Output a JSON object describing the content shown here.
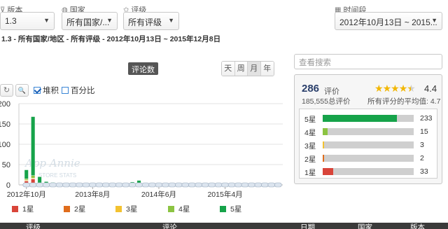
{
  "filters": {
    "version": {
      "label": "版本",
      "icon": "filter-icon",
      "value": "1.3"
    },
    "country": {
      "label": "国家",
      "icon": "globe-icon",
      "value": "所有国家/..."
    },
    "rating": {
      "label": "评级",
      "icon": "star-icon",
      "value": "所有评级"
    },
    "period": {
      "label": "时间段",
      "icon": "calendar-icon",
      "value": "2012年10月13日 ~ 2015..."
    }
  },
  "summary": "1.3 - 所有国家/地区 - 所有评级 - 2012年10月13日 ~ 2015年12月8日",
  "chart_header": {
    "title": "评论数",
    "granularity": [
      "天",
      "周",
      "月",
      "年"
    ],
    "active_granularity": "月",
    "tools": {
      "reset": "↻",
      "zoom": "🔍"
    },
    "stacked_label": "堆积",
    "percent_label": "百分比"
  },
  "chart_data": {
    "type": "bar",
    "stacked": true,
    "ylim": [
      0,
      200
    ],
    "y_ticks": [
      "0",
      "50",
      "100",
      "150",
      "200"
    ],
    "x_ticks": [
      "2012年10月",
      "2013年8月",
      "2014年6月",
      "2015年4月"
    ],
    "x": [
      "2012-10",
      "2012-11",
      "2012-12",
      "2013-01",
      "2013-02",
      "2013-03",
      "2013-04",
      "2013-05",
      "2013-06",
      "2013-07",
      "2013-08",
      "2013-09",
      "2013-10",
      "2013-11",
      "2013-12",
      "2014-01",
      "2014-02",
      "2014-03",
      "2014-04",
      "2014-05",
      "2014-06",
      "2014-07",
      "2014-08",
      "2014-09",
      "2014-10",
      "2014-11",
      "2014-12",
      "2015-01",
      "2015-02",
      "2015-03",
      "2015-04",
      "2015-05",
      "2015-06",
      "2015-07",
      "2015-08",
      "2015-09",
      "2015-10",
      "2015-11",
      "2015-12"
    ],
    "series": [
      {
        "name": "1星",
        "color": "#d9453a",
        "values": [
          10,
          15,
          2,
          1,
          1,
          0,
          0,
          0,
          0,
          0,
          0,
          1,
          0,
          0,
          0,
          0,
          1,
          1,
          0,
          0,
          0,
          0,
          0,
          0,
          0,
          0,
          0,
          0,
          0,
          0,
          0,
          0,
          0,
          0,
          0,
          0,
          0,
          0,
          0
        ]
      },
      {
        "name": "2星",
        "color": "#e06d1c",
        "values": [
          1,
          1,
          0,
          0,
          0,
          0,
          0,
          0,
          0,
          0,
          0,
          0,
          0,
          0,
          0,
          0,
          0,
          0,
          0,
          0,
          0,
          0,
          0,
          0,
          0,
          0,
          0,
          0,
          0,
          0,
          0,
          0,
          0,
          0,
          0,
          0,
          0,
          0,
          0
        ]
      },
      {
        "name": "3星",
        "color": "#f3c230",
        "values": [
          1,
          1,
          1,
          0,
          0,
          0,
          0,
          0,
          0,
          0,
          0,
          0,
          0,
          0,
          0,
          0,
          0,
          0,
          0,
          0,
          0,
          0,
          0,
          0,
          0,
          0,
          0,
          0,
          0,
          0,
          0,
          0,
          0,
          0,
          0,
          0,
          0,
          0,
          0
        ]
      },
      {
        "name": "4星",
        "color": "#8cc442",
        "values": [
          3,
          6,
          2,
          1,
          1,
          0,
          0,
          0,
          0,
          0,
          0,
          0,
          0,
          0,
          0,
          0,
          1,
          0,
          0,
          0,
          0,
          0,
          0,
          0,
          0,
          0,
          0,
          0,
          0,
          0,
          0,
          0,
          0,
          0,
          0,
          0,
          0,
          0,
          0
        ]
      },
      {
        "name": "5星",
        "color": "#16a34a",
        "values": [
          22,
          145,
          15,
          6,
          4,
          0,
          0,
          0,
          0,
          0,
          0,
          2,
          0,
          0,
          0,
          1,
          5,
          10,
          5,
          0,
          0,
          0,
          0,
          0,
          0,
          0,
          0,
          0,
          0,
          0,
          0,
          0,
          0,
          0,
          0,
          0,
          0,
          0,
          0
        ]
      }
    ],
    "watermark": [
      "App Annie",
      "STORE STATS"
    ]
  },
  "search": {
    "placeholder": "查看搜索"
  },
  "ratings_panel": {
    "total": "286",
    "total_label": "评价",
    "all_reviews": "185,555总评价",
    "average": "4.4",
    "average_label": "所有评分的平均值: 4.7",
    "average_value": 4.4,
    "rows": [
      {
        "label": "5星",
        "count": "233",
        "fraction": 0.815,
        "color": "#16a34a"
      },
      {
        "label": "4星",
        "count": "15",
        "fraction": 0.052,
        "color": "#8cc442"
      },
      {
        "label": "3星",
        "count": "3",
        "fraction": 0.012,
        "color": "#f3c230"
      },
      {
        "label": "2星",
        "count": "2",
        "fraction": 0.008,
        "color": "#e06d1c"
      },
      {
        "label": "1星",
        "count": "33",
        "fraction": 0.115,
        "color": "#d9453a"
      }
    ]
  },
  "table_header": {
    "col1": "评级",
    "col2": "评论",
    "col3": "日期",
    "col4": "国家",
    "col5": "版本"
  }
}
